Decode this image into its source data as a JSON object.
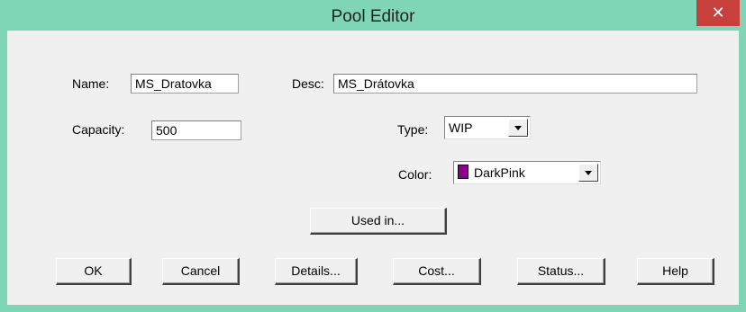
{
  "window": {
    "title": "Pool Editor",
    "close_glyph": "✕"
  },
  "form": {
    "name_label": "Name:",
    "name_value": "MS_Dratovka",
    "desc_label": "Desc:",
    "desc_value": "MS_Drátovka",
    "capacity_label": "Capacity:",
    "capacity_value": "500",
    "type_label": "Type:",
    "type_value": "WIP",
    "color_label": "Color:",
    "color_value": "DarkPink",
    "color_swatch": "#8b008b"
  },
  "buttons": {
    "used_in": "Used in...",
    "ok": "OK",
    "cancel": "Cancel",
    "details": "Details...",
    "cost": "Cost...",
    "status": "Status...",
    "help": "Help"
  },
  "colors": {
    "title_bar": "#7fd6b6",
    "close_button": "#c8403b"
  }
}
